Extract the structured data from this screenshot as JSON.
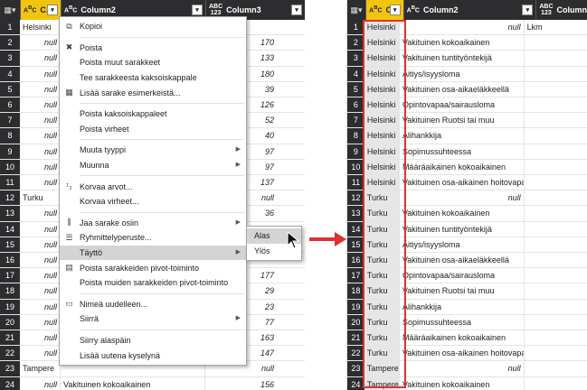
{
  "left": {
    "header": {
      "col1": "C...",
      "col2": "Column2",
      "col3": "Column3"
    },
    "rows": [
      {
        "n": "1",
        "c1": "Helsinki",
        "c2": "",
        "c3": ""
      },
      {
        "n": "2",
        "c1": "null",
        "c2": "",
        "c3": "170"
      },
      {
        "n": "3",
        "c1": "null",
        "c2": "",
        "c3": "133"
      },
      {
        "n": "4",
        "c1": "null",
        "c2": "",
        "c3": "180"
      },
      {
        "n": "5",
        "c1": "null",
        "c2": "",
        "c3": "39"
      },
      {
        "n": "6",
        "c1": "null",
        "c2": "",
        "c3": "126"
      },
      {
        "n": "7",
        "c1": "null",
        "c2": "",
        "c3": "52"
      },
      {
        "n": "8",
        "c1": "null",
        "c2": "",
        "c3": "40"
      },
      {
        "n": "9",
        "c1": "null",
        "c2": "",
        "c3": "97"
      },
      {
        "n": "10",
        "c1": "null",
        "c2": "",
        "c3": "97"
      },
      {
        "n": "11",
        "c1": "null",
        "c2": "",
        "c3": "137"
      },
      {
        "n": "12",
        "c1": "Turku",
        "c2": "",
        "c3": "null"
      },
      {
        "n": "13",
        "c1": "null",
        "c2": "",
        "c3": "36"
      },
      {
        "n": "14",
        "c1": "null",
        "c2": "",
        "c3": "64"
      },
      {
        "n": "15",
        "c1": "null",
        "c2": "",
        "c3": "16"
      },
      {
        "n": "16",
        "c1": "null",
        "c2": "",
        "c3": ""
      },
      {
        "n": "17",
        "c1": "null",
        "c2": "",
        "c3": "177"
      },
      {
        "n": "18",
        "c1": "null",
        "c2": "",
        "c3": "29"
      },
      {
        "n": "19",
        "c1": "null",
        "c2": "",
        "c3": "23"
      },
      {
        "n": "20",
        "c1": "null",
        "c2": "",
        "c3": "77"
      },
      {
        "n": "21",
        "c1": "null",
        "c2": "",
        "c3": "163"
      },
      {
        "n": "22",
        "c1": "null",
        "c2": "Vakituinen osa-aikainen hoitovapaa",
        "c3": "147"
      },
      {
        "n": "23",
        "c1": "Tampere",
        "c2": "",
        "c3": "null"
      },
      {
        "n": "24",
        "c1": "null",
        "c2": "Vakituinen kokoaikainen",
        "c3": "156"
      },
      {
        "n": "25",
        "c1": "null",
        "c2": "Vakituinen  tuntityöntekijä",
        "c3": "15"
      }
    ]
  },
  "menu": {
    "items": [
      {
        "label": "Kopioi",
        "icon": "copy-icon",
        "glyph": "⧉",
        "sub": false,
        "sep_after": true
      },
      {
        "label": "Poista",
        "icon": "delete-icon",
        "glyph": "✖",
        "sub": false,
        "sep_after": false
      },
      {
        "label": "Poista muut sarakkeet",
        "icon": "",
        "glyph": "",
        "sub": false,
        "sep_after": false
      },
      {
        "label": "Tee sarakkeesta kaksoiskappale",
        "icon": "",
        "glyph": "",
        "sub": false,
        "sep_after": false
      },
      {
        "label": "Lisää sarake esimerkeistä...",
        "icon": "column-from-examples-icon",
        "glyph": "▦",
        "sub": false,
        "sep_after": true
      },
      {
        "label": "Poista kaksoiskappaleet",
        "icon": "",
        "glyph": "",
        "sub": false,
        "sep_after": false
      },
      {
        "label": "Poista virheet",
        "icon": "",
        "glyph": "",
        "sub": false,
        "sep_after": true
      },
      {
        "label": "Muuta tyyppi",
        "icon": "",
        "glyph": "",
        "sub": true,
        "sep_after": false
      },
      {
        "label": "Muunna",
        "icon": "",
        "glyph": "",
        "sub": true,
        "sep_after": true
      },
      {
        "label": "Korvaa arvot...",
        "icon": "replace-values-icon",
        "glyph": "¹₂",
        "sub": false,
        "sep_after": false
      },
      {
        "label": "Korvaa virheet...",
        "icon": "",
        "glyph": "",
        "sub": false,
        "sep_after": true
      },
      {
        "label": "Jaa sarake osiin",
        "icon": "split-column-icon",
        "glyph": "⫼",
        "sub": true,
        "sep_after": false
      },
      {
        "label": "Ryhmittelyperuste...",
        "icon": "group-by-icon",
        "glyph": "☰",
        "sub": false,
        "sep_after": false
      },
      {
        "label": "Täyttö",
        "icon": "",
        "glyph": "",
        "sub": true,
        "sep_after": false,
        "highlight": true
      },
      {
        "label": "Poista sarakkeiden pivot-toiminto",
        "icon": "unpivot-icon",
        "glyph": "▤",
        "sub": false,
        "sep_after": false
      },
      {
        "label": "Poista muiden sarakkeiden pivot-toiminto",
        "icon": "",
        "glyph": "",
        "sub": false,
        "sep_after": true
      },
      {
        "label": "Nimeä uudelleen...",
        "icon": "rename-icon",
        "glyph": "▭",
        "sub": false,
        "sep_after": false
      },
      {
        "label": "Siirrä",
        "icon": "",
        "glyph": "",
        "sub": true,
        "sep_after": true
      },
      {
        "label": "Siirry alaspäin",
        "icon": "",
        "glyph": "",
        "sub": false,
        "sep_after": false
      },
      {
        "label": "Lisää uutena kyselynä",
        "icon": "",
        "glyph": "",
        "sub": false,
        "sep_after": false
      }
    ],
    "submenu": [
      {
        "label": "Alas",
        "highlight": true
      },
      {
        "label": "Ylös",
        "highlight": false
      }
    ]
  },
  "right": {
    "header": {
      "col1": "C...",
      "col2": "Column2",
      "col3": "Column"
    },
    "rows": [
      {
        "n": "1",
        "c1": "Helsinki",
        "c2": "",
        "c3": "Lkm",
        "c2null": true
      },
      {
        "n": "2",
        "c1": "Helsinki",
        "c2": "Vakituinen kokoaikainen",
        "c3": ""
      },
      {
        "n": "3",
        "c1": "Helsinki",
        "c2": "Vakituinen  tuntityöntekijä",
        "c3": ""
      },
      {
        "n": "4",
        "c1": "Helsinki",
        "c2": "Äitiys/isyysloma",
        "c3": ""
      },
      {
        "n": "5",
        "c1": "Helsinki",
        "c2": "Vakituinen osa-aikaeläkkeellä",
        "c3": ""
      },
      {
        "n": "6",
        "c1": "Helsinki",
        "c2": "Opintovapaa/sairausloma",
        "c3": ""
      },
      {
        "n": "7",
        "c1": "Helsinki",
        "c2": "Vakituinen Ruotsi tai muu",
        "c3": ""
      },
      {
        "n": "8",
        "c1": "Helsinki",
        "c2": "Alihankkija",
        "c3": ""
      },
      {
        "n": "9",
        "c1": "Helsinki",
        "c2": "Sopimussuhteessa",
        "c3": ""
      },
      {
        "n": "10",
        "c1": "Helsinki",
        "c2": "Määräaikainen kokoaikainen",
        "c3": ""
      },
      {
        "n": "11",
        "c1": "Helsinki",
        "c2": "Vakituinen osa-aikainen hoitovapaa",
        "c3": ""
      },
      {
        "n": "12",
        "c1": "Turku",
        "c2": "",
        "c3": "",
        "c2null": true
      },
      {
        "n": "13",
        "c1": "Turku",
        "c2": "Vakituinen kokoaikainen",
        "c3": ""
      },
      {
        "n": "14",
        "c1": "Turku",
        "c2": "Vakituinen  tuntityöntekijä",
        "c3": ""
      },
      {
        "n": "15",
        "c1": "Turku",
        "c2": "Äitiys/isyysloma",
        "c3": ""
      },
      {
        "n": "16",
        "c1": "Turku",
        "c2": "Vakituinen osa-aikaeläkkeellä",
        "c3": ""
      },
      {
        "n": "17",
        "c1": "Turku",
        "c2": "Opintovapaa/sairausloma",
        "c3": ""
      },
      {
        "n": "18",
        "c1": "Turku",
        "c2": "Vakituinen Ruotsi tai muu",
        "c3": ""
      },
      {
        "n": "19",
        "c1": "Turku",
        "c2": "Alihankkija",
        "c3": ""
      },
      {
        "n": "20",
        "c1": "Turku",
        "c2": "Sopimussuhteessa",
        "c3": ""
      },
      {
        "n": "21",
        "c1": "Turku",
        "c2": "Määräaikainen kokoaikainen",
        "c3": ""
      },
      {
        "n": "22",
        "c1": "Turku",
        "c2": "Vakituinen osa-aikainen hoitovapaa",
        "c3": ""
      },
      {
        "n": "23",
        "c1": "Tampere",
        "c2": "",
        "c3": "",
        "c2null": true
      },
      {
        "n": "24",
        "c1": "Tampere",
        "c2": "Vakituinen kokoaikainen",
        "c3": ""
      },
      {
        "n": "25",
        "c1": "Tampere",
        "c2": "Vakituinen  tuntityöntekijä",
        "c3": ""
      }
    ]
  },
  "null_label": "null",
  "type_labels": {
    "abc": "ABC",
    "n123": "123"
  },
  "colors": {
    "header_bg": "#2d2d30",
    "selected_col": "#f1c40f",
    "highlight_arrow": "#e03030"
  }
}
